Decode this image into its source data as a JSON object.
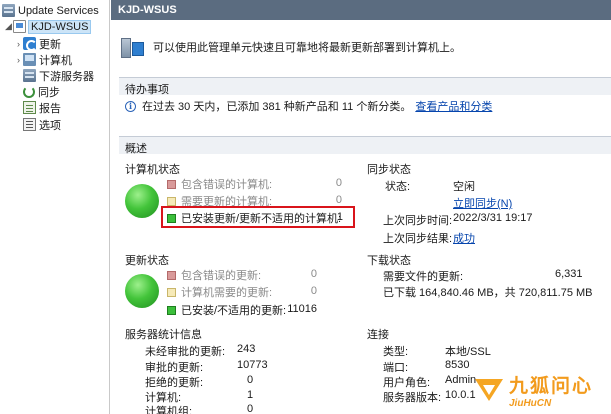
{
  "tree": {
    "root": "Update Services",
    "server": "KJD-WSUS",
    "items": [
      {
        "label": "更新",
        "icon": "update-icon",
        "expandable": true
      },
      {
        "label": "计算机",
        "icon": "computer-icon",
        "expandable": true
      },
      {
        "label": "下游服务器",
        "icon": "server-icon",
        "expandable": false
      },
      {
        "label": "同步",
        "icon": "sync-icon",
        "expandable": false
      },
      {
        "label": "报告",
        "icon": "report-icon",
        "expandable": false
      },
      {
        "label": "选项",
        "icon": "options-icon",
        "expandable": false
      }
    ]
  },
  "main": {
    "title": "KJD-WSUS",
    "intro": "可以使用此管理单元快速且可靠地将最新更新部署到计算机上。",
    "pending": {
      "header": "待办事项",
      "text": "在过去 30 天内，已添加 381 种新产品和 11 个新分类。",
      "link": "查看产品和分类"
    },
    "overview": {
      "header": "概述",
      "computer_status": {
        "title": "计算机状态",
        "rows": [
          {
            "label": "包含错误的计算机:",
            "value": "0",
            "color": "red",
            "dim": true
          },
          {
            "label": "需要更新的计算机:",
            "value": "0",
            "color": "yellow",
            "dim": true
          },
          {
            "label": "已安装更新/更新不适用的计算机:",
            "value": "1",
            "color": "green",
            "dim": false
          }
        ]
      },
      "update_status": {
        "title": "更新状态",
        "rows": [
          {
            "label": "包含错误的更新:",
            "value": "0",
            "color": "red",
            "dim": true
          },
          {
            "label": "计算机需要的更新:",
            "value": "0",
            "color": "yellow",
            "dim": true
          },
          {
            "label": "已安装/不适用的更新:",
            "value": "11016",
            "color": "green",
            "dim": false
          }
        ]
      },
      "server_stats": {
        "title": "服务器统计信息",
        "rows": [
          {
            "label": "未经审批的更新:",
            "value": "243"
          },
          {
            "label": "审批的更新:",
            "value": "10773"
          },
          {
            "label": "拒绝的更新:",
            "value": "0"
          },
          {
            "label": "计算机:",
            "value": "1"
          },
          {
            "label": "计算机组:",
            "value": "0"
          }
        ]
      },
      "sync_status": {
        "title": "同步状态",
        "status_label": "状态:",
        "status_value": "空闲",
        "sync_now": "立即同步(N)",
        "last_sync_time_label": "上次同步时间:",
        "last_sync_time_value": "2022/3/31 19:17",
        "last_sync_result_label": "上次同步结果:",
        "last_sync_result_value": "成功"
      },
      "download_status": {
        "title": "下载状态",
        "files_label": "需要文件的更新:",
        "files_value": "6,331",
        "downloaded": "已下载 164,840.46 MB，共 720,811.75 MB"
      },
      "connection": {
        "title": "连接",
        "rows": [
          {
            "label": "类型:",
            "value": "本地/SSL"
          },
          {
            "label": "端口:",
            "value": "8530"
          },
          {
            "label": "用户角色:",
            "value": "Admin"
          },
          {
            "label": "服务器版本:",
            "value": "10.0.1"
          }
        ]
      }
    }
  },
  "watermark": {
    "text": "九狐问心",
    "sub": "JiuHuCN"
  }
}
